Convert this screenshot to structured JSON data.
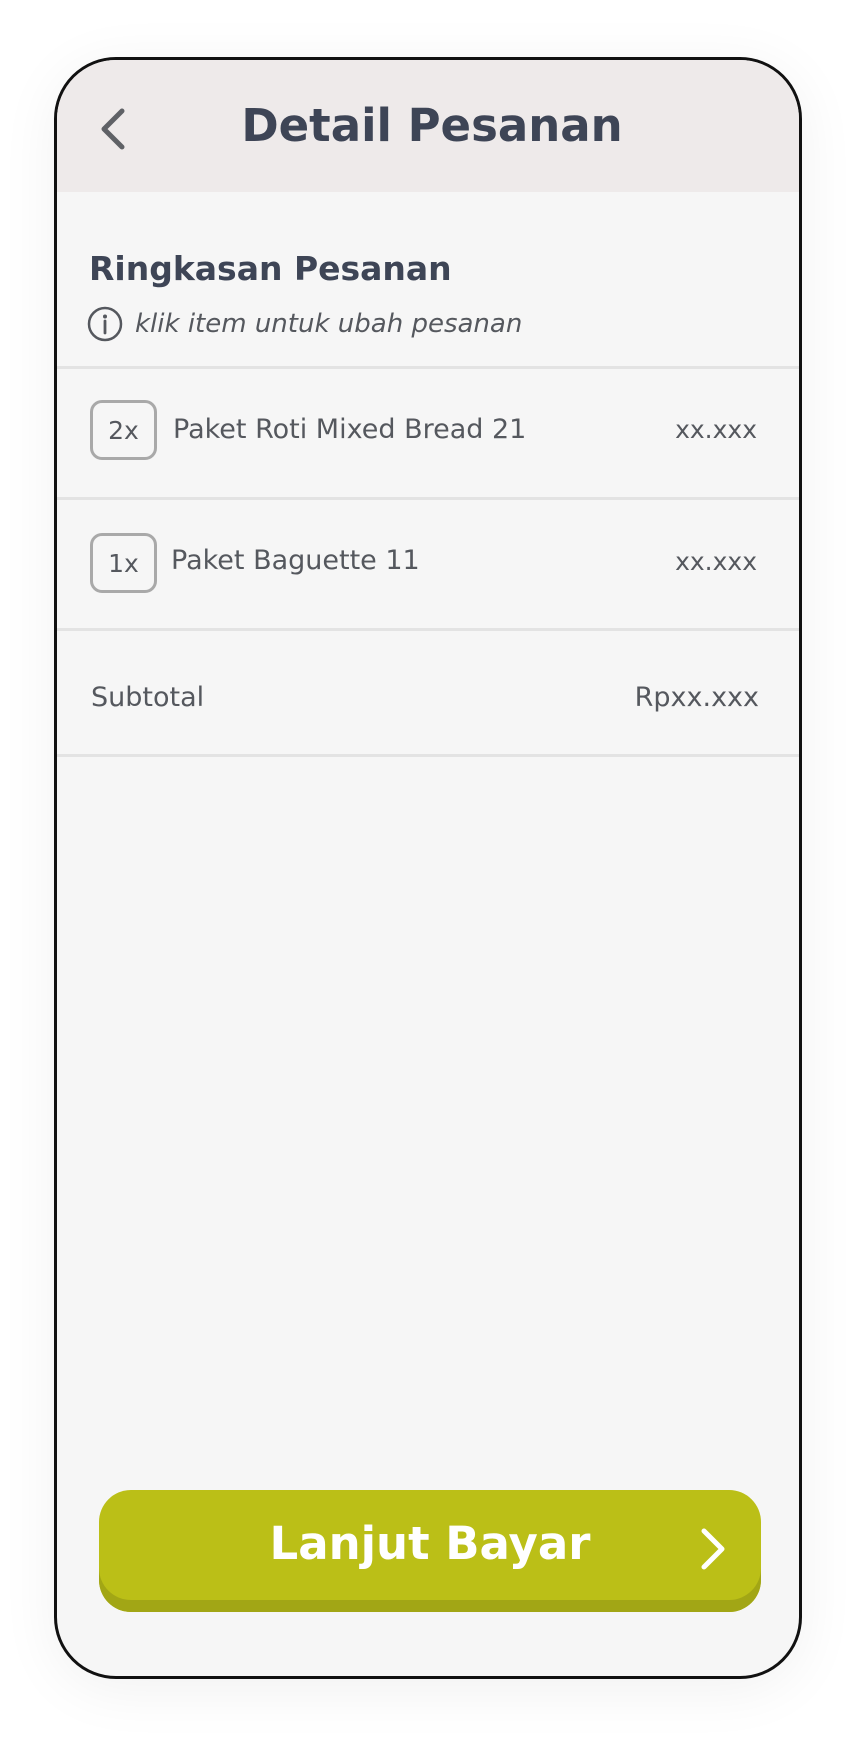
{
  "header": {
    "title": "Detail Pesanan",
    "back_icon": "chevron-left-icon"
  },
  "summary": {
    "title": "Ringkasan Pesanan",
    "hint_icon": "info-icon",
    "hint": "klik item untuk ubah pesanan"
  },
  "items": [
    {
      "qty": "2x",
      "name": "Paket Roti Mixed Bread 21",
      "price": "xx.xxx"
    },
    {
      "qty": "1x",
      "name": "Paket Baguette 11",
      "price": "xx.xxx"
    }
  ],
  "subtotal": {
    "label": "Subtotal",
    "value": "Rpxx.xxx"
  },
  "pay_button": {
    "label": "Lanjut Bayar",
    "icon": "chevron-right-icon"
  },
  "colors": {
    "header_bg": "#eeeaea",
    "title_text": "#3e4556",
    "body_text": "#55585e",
    "accent": "#bbbf17",
    "background": "#f6f6f6"
  }
}
